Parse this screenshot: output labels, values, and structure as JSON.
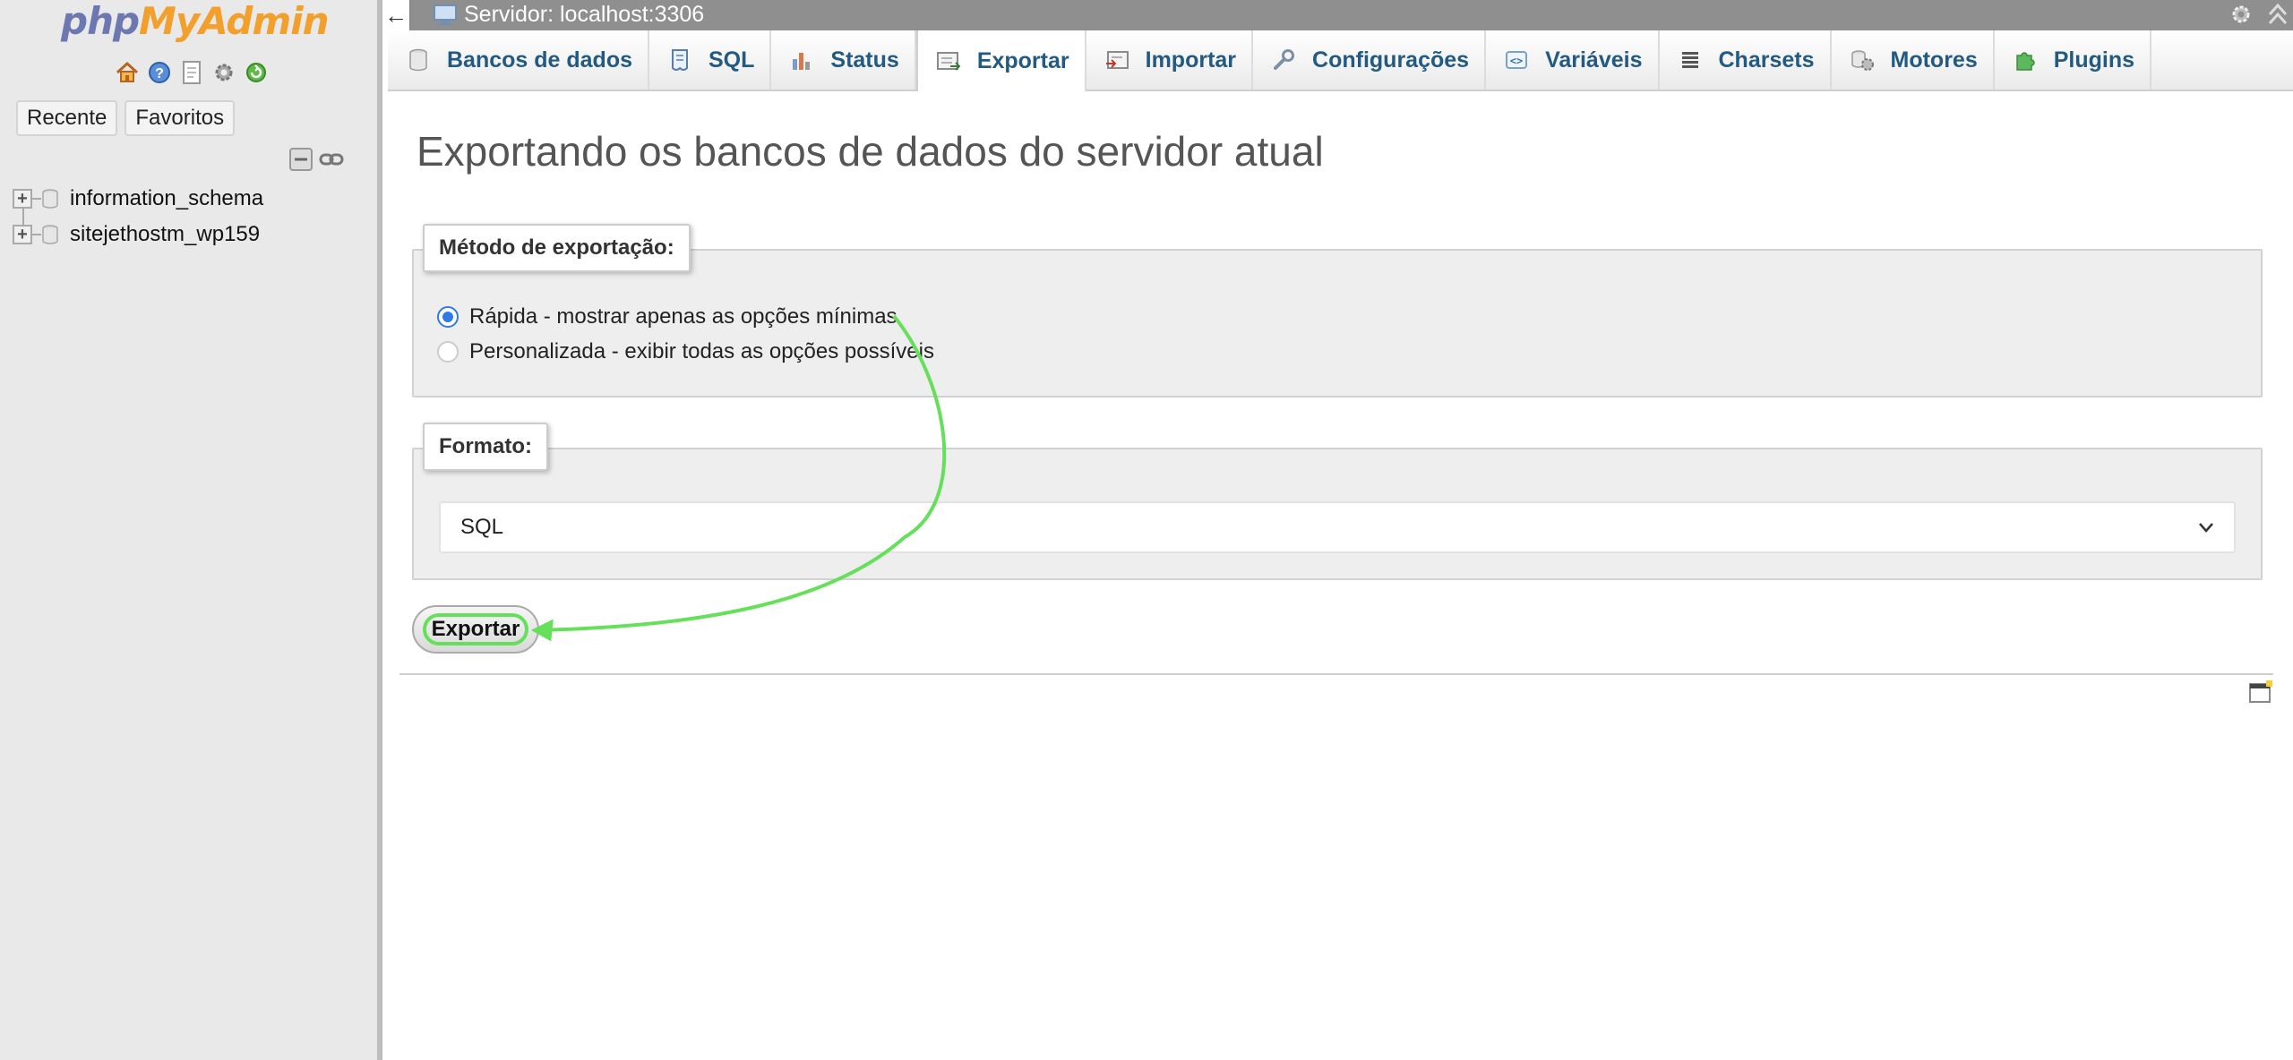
{
  "sidebar": {
    "logo_php": "php",
    "logo_myadmin": "MyAdmin",
    "quick_icons": [
      "home-icon",
      "help-icon",
      "docs-icon",
      "settings-icon",
      "reload-icon"
    ],
    "tabs": [
      "Recente",
      "Favoritos"
    ],
    "databases": [
      "information_schema",
      "sitejethostm_wp159"
    ]
  },
  "topbar": {
    "back": "←",
    "server_label": "Servidor: localhost:3306"
  },
  "menu": {
    "tabs": [
      "Bancos de dados",
      "SQL",
      "Status",
      "Exportar",
      "Importar",
      "Configurações",
      "Variáveis",
      "Charsets",
      "Motores",
      "Plugins"
    ],
    "active": "Exportar"
  },
  "main": {
    "title": "Exportando os bancos de dados do servidor atual",
    "method_legend": "Método de exportação:",
    "method_quick": "Rápida - mostrar apenas as opções mínimas",
    "method_custom": "Personalizada - exibir todas as opções possíveis",
    "format_legend": "Formato:",
    "format_value": "SQL",
    "export_button": "Exportar"
  },
  "colors": {
    "accent_link": "#235a81",
    "radio_checked": "#2f7be6",
    "annotation_arrow": "#66e05a"
  }
}
